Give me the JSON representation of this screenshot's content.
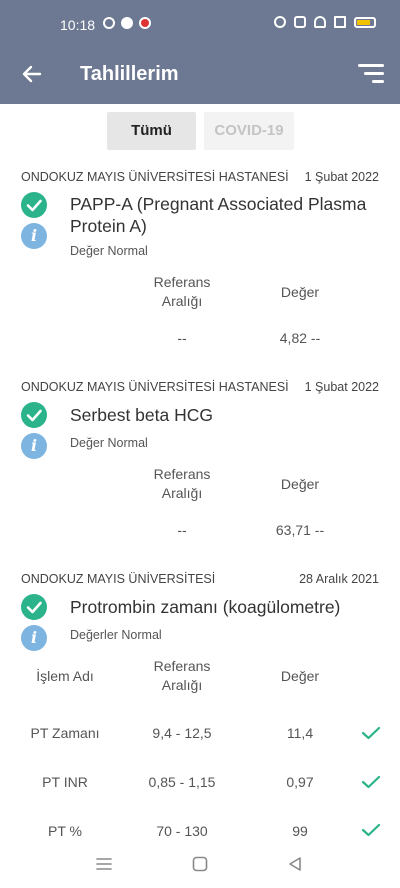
{
  "status_bar": {
    "time": "10:18"
  },
  "app_bar": {
    "title": "Tahlillerim"
  },
  "tabs": [
    {
      "label": "Tümü"
    },
    {
      "label": "COVID-19"
    }
  ],
  "results": [
    {
      "hospital": "ONDOKUZ MAYIS ÜNİVERSİTESİ HASTANESİ",
      "date": "1 Şubat 2022",
      "test_name": "PAPP-A (Pregnant Associated Plasma Protein A)",
      "status": "Değer Normal",
      "headers": {
        "reference": [
          "Referans",
          "Aralığı"
        ],
        "value": "Değer"
      },
      "rows": [
        {
          "reference": "--",
          "value": "4,82 --"
        }
      ]
    },
    {
      "hospital": "ONDOKUZ MAYIS ÜNİVERSİTESİ HASTANESİ",
      "date": "1 Şubat 2022",
      "test_name": "Serbest beta HCG",
      "status": "Değer Normal",
      "headers": {
        "reference": [
          "Referans",
          "Aralığı"
        ],
        "value": "Değer"
      },
      "rows": [
        {
          "reference": "--",
          "value": "63,71 --"
        }
      ]
    },
    {
      "hospital": "ONDOKUZ MAYIS ÜNİVERSİTESİ",
      "date": "28 Aralık 2021",
      "test_name": "Protrombin zamanı (koagülometre)",
      "status": "Değerler Normal",
      "headers": {
        "name": "İşlem Adı",
        "reference": [
          "Referans",
          "Aralığı"
        ],
        "value": "Değer"
      },
      "rows": [
        {
          "name": "PT Zamanı",
          "reference": "9,4 - 12,5",
          "value": "11,4"
        },
        {
          "name": "PT INR",
          "reference": "0,85 - 1,15",
          "value": "0,97"
        },
        {
          "name": "PT %",
          "reference": "70 - 130",
          "value": "99"
        }
      ]
    }
  ],
  "colors": {
    "header": "#6d7993",
    "check": "#2bb38b",
    "info": "#7db4e0",
    "tick": "#2bb38b"
  },
  "icons": [
    "back-arrow-icon",
    "filter-menu-icon",
    "check-circle-icon",
    "info-icon",
    "checkmark-icon",
    "nav-menu-icon",
    "nav-home-icon",
    "nav-back-icon"
  ]
}
